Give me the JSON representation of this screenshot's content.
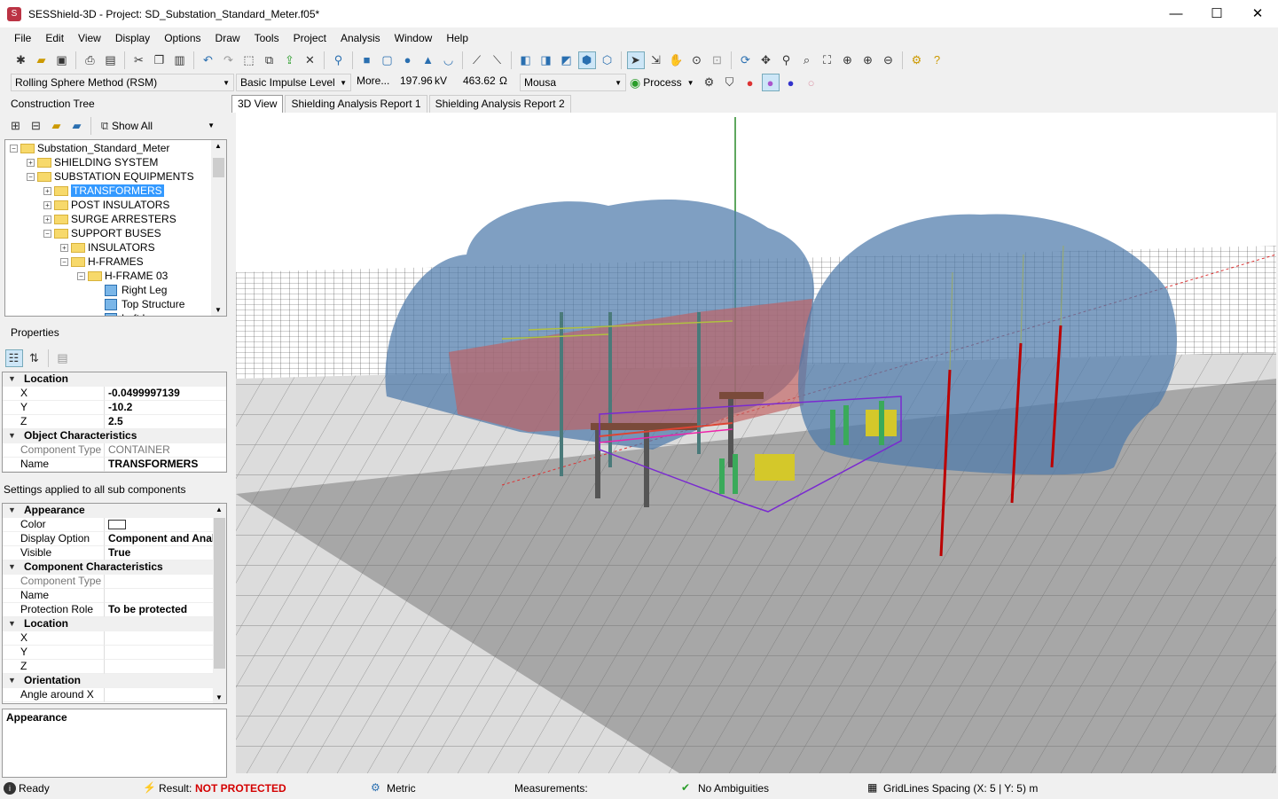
{
  "window": {
    "title": "SESShield-3D - Project: SD_Substation_Standard_Meter.f05*",
    "min": "—",
    "max": "☐",
    "close": "✕"
  },
  "menu": [
    "File",
    "Edit",
    "View",
    "Display",
    "Options",
    "Draw",
    "Tools",
    "Project",
    "Analysis",
    "Window",
    "Help"
  ],
  "toolbar2": {
    "method": "Rolling Sphere Method (RSM)",
    "level": "Basic Impulse Level",
    "more": "More...",
    "kv_value": "197.96",
    "kv_unit": "kV",
    "ohm_value": "463.62",
    "ohm_unit": "Ω",
    "model": "Mousa",
    "process": "Process"
  },
  "construction_tree": {
    "title": "Construction Tree",
    "filter": "Show All",
    "nodes": [
      {
        "label": "Substation_Standard_Meter",
        "level": 0,
        "type": "folder",
        "sign": "−"
      },
      {
        "label": "SHIELDING SYSTEM",
        "level": 1,
        "type": "folder",
        "sign": "+"
      },
      {
        "label": "SUBSTATION EQUIPMENTS",
        "level": 1,
        "type": "folder",
        "sign": "−"
      },
      {
        "label": "TRANSFORMERS",
        "level": 2,
        "type": "folder",
        "sign": "+",
        "selected": true
      },
      {
        "label": "POST INSULATORS",
        "level": 2,
        "type": "folder",
        "sign": "+"
      },
      {
        "label": "SURGE ARRESTERS",
        "level": 2,
        "type": "folder",
        "sign": "+"
      },
      {
        "label": "SUPPORT BUSES",
        "level": 2,
        "type": "folder",
        "sign": "−"
      },
      {
        "label": "INSULATORS",
        "level": 3,
        "type": "folder",
        "sign": "+"
      },
      {
        "label": "H-FRAMES",
        "level": 3,
        "type": "folder",
        "sign": "−"
      },
      {
        "label": "H-FRAME 03",
        "level": 4,
        "type": "folder",
        "sign": "−"
      },
      {
        "label": "Right Leg",
        "level": 5,
        "type": "cube",
        "sign": ""
      },
      {
        "label": "Top Structure",
        "level": 5,
        "type": "cube",
        "sign": ""
      },
      {
        "label": "Left Leg",
        "level": 5,
        "type": "cube",
        "sign": ""
      }
    ]
  },
  "properties": {
    "title": "Properties",
    "rows": [
      {
        "cat": "Location"
      },
      {
        "k": "X",
        "v": "-0.0499997139"
      },
      {
        "k": "Y",
        "v": "-10.2"
      },
      {
        "k": "Z",
        "v": "2.5"
      },
      {
        "cat": "Object Characteristics"
      },
      {
        "k": "Component Type",
        "v": "CONTAINER",
        "gray": true
      },
      {
        "k": "Name",
        "v": "TRANSFORMERS"
      }
    ]
  },
  "settings": {
    "label": "Settings applied to all sub components",
    "rows": [
      {
        "cat": "Appearance"
      },
      {
        "k": "Color",
        "v": "",
        "swatch": true
      },
      {
        "k": "Display Option",
        "v": "Component and Analysis"
      },
      {
        "k": "Visible",
        "v": "True"
      },
      {
        "cat": "Component Characteristics"
      },
      {
        "k": "Component Type",
        "v": "",
        "gray": true
      },
      {
        "k": "Name",
        "v": ""
      },
      {
        "k": "Protection Role",
        "v": "To be protected"
      },
      {
        "cat": "Location"
      },
      {
        "k": "X",
        "v": ""
      },
      {
        "k": "Y",
        "v": ""
      },
      {
        "k": "Z",
        "v": ""
      },
      {
        "cat": "Orientation"
      },
      {
        "k": "Angle around X",
        "v": ""
      }
    ]
  },
  "description_box": {
    "title": "Appearance"
  },
  "tabs": [
    "3D View",
    "Shielding Analysis Report 1",
    "Shielding Analysis Report 2"
  ],
  "status": {
    "ready": "Ready",
    "result_label": "Result:",
    "result_value": "NOT PROTECTED",
    "units": "Metric",
    "measurements": "Measurements:",
    "ambiguities": "No Ambiguities",
    "gridlines": "GridLines Spacing (X: 5 | Y: 5) m",
    "result_color": "#d40000"
  }
}
